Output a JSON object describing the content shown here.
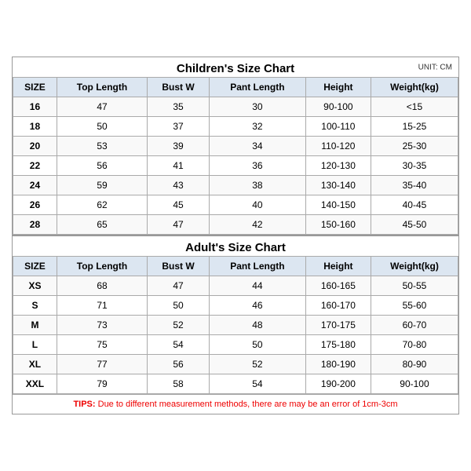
{
  "children_title": "Children's Size Chart",
  "adult_title": "Adult's Size Chart",
  "unit_label": "UNIT: CM",
  "headers": [
    "SIZE",
    "Top Length",
    "Bust W",
    "Pant Length",
    "Height",
    "Weight(kg)"
  ],
  "children_rows": [
    [
      "16",
      "47",
      "35",
      "30",
      "90-100",
      "<15"
    ],
    [
      "18",
      "50",
      "37",
      "32",
      "100-110",
      "15-25"
    ],
    [
      "20",
      "53",
      "39",
      "34",
      "110-120",
      "25-30"
    ],
    [
      "22",
      "56",
      "41",
      "36",
      "120-130",
      "30-35"
    ],
    [
      "24",
      "59",
      "43",
      "38",
      "130-140",
      "35-40"
    ],
    [
      "26",
      "62",
      "45",
      "40",
      "140-150",
      "40-45"
    ],
    [
      "28",
      "65",
      "47",
      "42",
      "150-160",
      "45-50"
    ]
  ],
  "adult_rows": [
    [
      "XS",
      "68",
      "47",
      "44",
      "160-165",
      "50-55"
    ],
    [
      "S",
      "71",
      "50",
      "46",
      "160-170",
      "55-60"
    ],
    [
      "M",
      "73",
      "52",
      "48",
      "170-175",
      "60-70"
    ],
    [
      "L",
      "75",
      "54",
      "50",
      "175-180",
      "70-80"
    ],
    [
      "XL",
      "77",
      "56",
      "52",
      "180-190",
      "80-90"
    ],
    [
      "XXL",
      "79",
      "58",
      "54",
      "190-200",
      "90-100"
    ]
  ],
  "tips_prefix": "TIPS:",
  "tips_text": " Due to different measurement methods, there are may be an error of 1cm-3cm"
}
